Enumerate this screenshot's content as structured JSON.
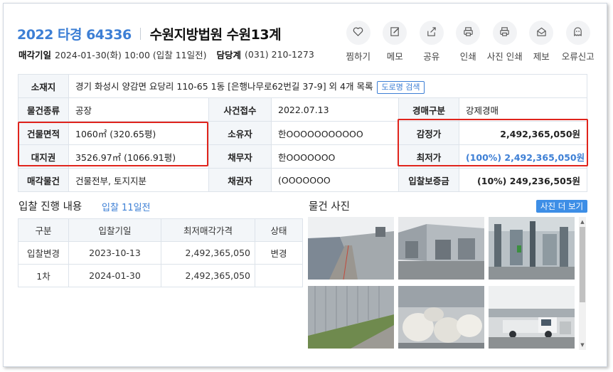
{
  "header": {
    "case_number": "2022 타경 64336",
    "court": "수원지방법원 수원13계"
  },
  "subhead": {
    "sale_date_label": "매각기일",
    "sale_date_value": "2024-01-30(화) 10:00 (입찰 11일전)",
    "department_label": "담당계",
    "department_phone": "(031) 210-1273"
  },
  "actions": [
    {
      "label": "찜하기",
      "icon": "heart-icon"
    },
    {
      "label": "메모",
      "icon": "pencil-icon"
    },
    {
      "label": "공유",
      "icon": "share-icon"
    },
    {
      "label": "인쇄",
      "icon": "printer-icon"
    },
    {
      "label": "사진 인쇄",
      "icon": "printer-icon"
    },
    {
      "label": "제보",
      "icon": "envelope-icon"
    },
    {
      "label": "오류신고",
      "icon": "ghost-icon"
    }
  ],
  "info": {
    "location_label": "소재지",
    "location_value": "경기 화성시 양감면 요당리 110-65 1동 [은행나무로62번길 37-9] 외 4개 목록",
    "road_search_button": "도로명 검색",
    "property_type_label": "물건종류",
    "property_type_value": "공장",
    "case_received_label": "사건접수",
    "case_received_value": "2022.07.13",
    "auction_type_label": "경매구분",
    "auction_type_value": "강제경매",
    "building_area_label": "건물면적",
    "building_area_value": "1060㎡ (320.65평)",
    "owner_label": "소유자",
    "owner_value": "한OOOOOOOOOOO",
    "appraisal_label": "감정가",
    "appraisal_value": "2,492,365,050원",
    "land_right_label": "대지권",
    "land_right_value": "3526.97㎡ (1066.91평)",
    "debtor_label": "채무자",
    "debtor_value": "한OOOOOOO",
    "minimum_label": "최저가",
    "minimum_value": "(100%) 2,492,365,050원",
    "sale_items_label": "매각물건",
    "sale_items_value": "건물전부, 토지지분",
    "creditor_label": "채권자",
    "creditor_value": "(OOOOOOO",
    "deposit_label": "입찰보증금",
    "deposit_value": "(10%) 249,236,505원"
  },
  "bids": {
    "title": "입찰 진행 내용",
    "subtitle": "입찰 11일전",
    "headers": [
      "구분",
      "입찰기일",
      "최저매각가격",
      "상태"
    ],
    "rows": [
      {
        "round": "입찰변경",
        "date": "2023-10-13",
        "price": "2,492,365,050",
        "status": "변경"
      },
      {
        "round": "1차",
        "date": "2024-01-30",
        "price": "2,492,365,050",
        "status": ""
      }
    ]
  },
  "photos": {
    "title": "물건 사진",
    "more_button": "사진 더 보기"
  },
  "colors": {
    "accent": "#3d7fd5",
    "highlight_box": "#e0241c",
    "header_cell_bg": "#f3f6f9"
  }
}
